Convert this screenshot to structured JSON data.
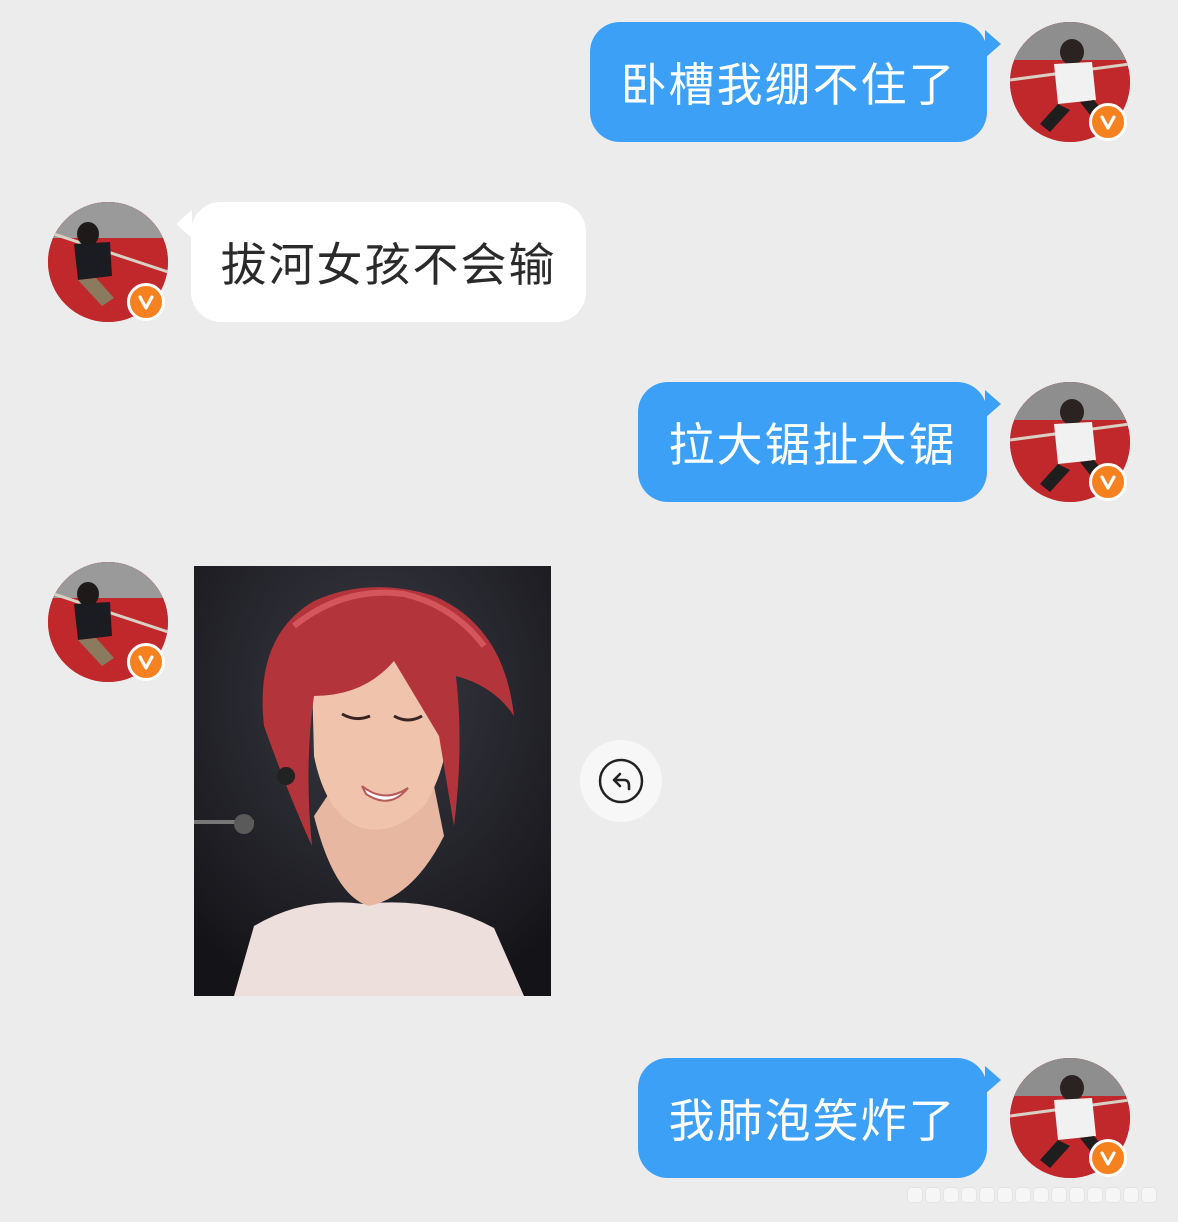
{
  "chat": {
    "messages": [
      {
        "direction": "outgoing",
        "type": "text",
        "text": "卧槽我绷不住了"
      },
      {
        "direction": "incoming",
        "type": "text",
        "text": "拔河女孩不会输"
      },
      {
        "direction": "outgoing",
        "type": "text",
        "text": "拉大锯扯大锯"
      },
      {
        "direction": "incoming",
        "type": "image"
      },
      {
        "direction": "outgoing",
        "type": "text",
        "text": "我肺泡笑炸了"
      }
    ]
  },
  "badges": {
    "verified_glyph": "v",
    "verified_color": "#f5821f"
  },
  "colors": {
    "background": "#ececec",
    "outgoing_bubble": "#3ca0f6",
    "incoming_bubble": "#ffffff"
  },
  "icons": {
    "forward": "forward-icon"
  }
}
